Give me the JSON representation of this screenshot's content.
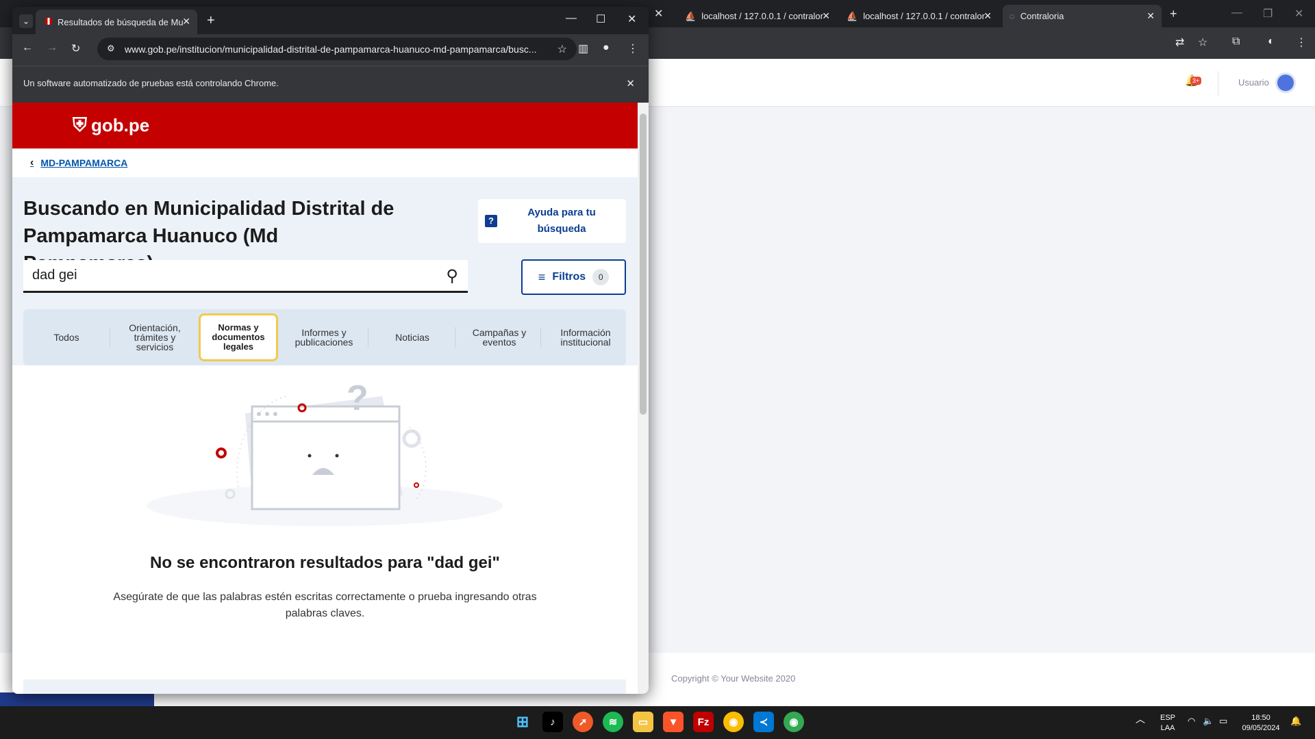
{
  "background_window": {
    "tabs": [
      {
        "label": "localhost / 127.0.0.1 / contralor"
      },
      {
        "label": "localhost / 127.0.0.1 / contralor"
      },
      {
        "label": "Contraloria"
      }
    ],
    "notification_badge": "3+",
    "user_label": "Usuario",
    "footer": "Copyright © Your Website 2020"
  },
  "front_window": {
    "tab_title": "Resultados de búsqueda de Mu",
    "url": "www.gob.pe/institucion/municipalidad-distrital-de-pampamarca-huanuco-md-pampamarca/busc...",
    "automation_notice": "Un software automatizado de pruebas está controlando Chrome.",
    "logo_text": "gob.pe",
    "breadcrumb": "MD-PAMPAMARCA",
    "page_title": "Buscando en Municipalidad Distrital de Pampamarca Huanuco (Md Pampamarca)",
    "help_label": "Ayuda para tu búsqueda",
    "help_icon": "?",
    "search_value": "dad gei",
    "filters_label": "Filtros",
    "filters_count": "0",
    "categories": [
      {
        "label": "Todos"
      },
      {
        "label": "Orientación, trámites y servicios"
      },
      {
        "label": "Normas y documentos legales"
      },
      {
        "label": "Informes y publicaciones"
      },
      {
        "label": "Noticias"
      },
      {
        "label": "Campañas y eventos"
      },
      {
        "label": "Información institucional"
      }
    ],
    "selected_category": "Normas y documentos legales",
    "no_results_title": "No se encontraron resultados para \"dad gei\"",
    "no_results_sub": "Asegúrate de que las palabras estén escritas correctamente o prueba ingresando otras palabras claves."
  },
  "taskbar": {
    "lang_top": "ESP",
    "lang_bottom": "LAA",
    "time": "18:50",
    "date": "09/05/2024"
  },
  "colors": {
    "gob_red": "#c40000",
    "gob_blue": "#0b3d91",
    "highlight": "#f2c94c"
  }
}
